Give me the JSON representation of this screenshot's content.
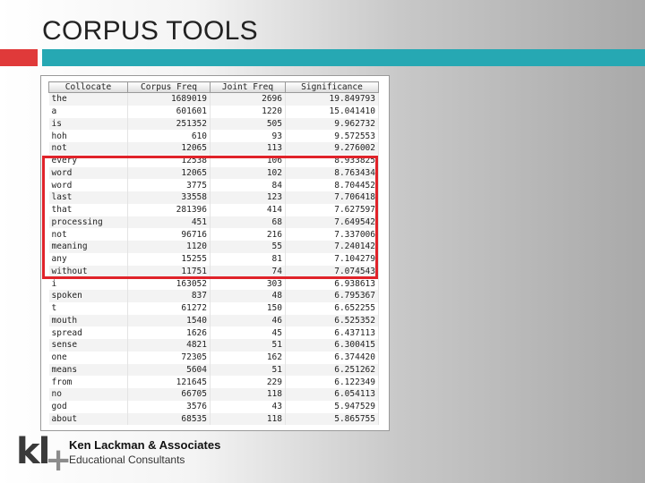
{
  "slide": {
    "title": "CORPUS TOOLS"
  },
  "table": {
    "headers": [
      "Collocate",
      "Corpus Freq",
      "Joint Freq",
      "Significance"
    ],
    "rows": [
      [
        "the",
        "1689019",
        "2696",
        "19.849793"
      ],
      [
        "a",
        "601601",
        "1220",
        "15.041410"
      ],
      [
        "is",
        "251352",
        "505",
        "9.962732"
      ],
      [
        "hoh",
        "610",
        "93",
        "9.572553"
      ],
      [
        "not",
        "12065",
        "113",
        "9.276002"
      ],
      [
        "every",
        "12538",
        "106",
        "8.933825"
      ],
      [
        "word",
        "12065",
        "102",
        "8.763434"
      ],
      [
        "word",
        "3775",
        "84",
        "8.704452"
      ],
      [
        "last",
        "33558",
        "123",
        "7.706418"
      ],
      [
        "that",
        "281396",
        "414",
        "7.627597"
      ],
      [
        "processing",
        "451",
        "68",
        "7.649542"
      ],
      [
        "not",
        "96716",
        "216",
        "7.337006"
      ],
      [
        "meaning",
        "1120",
        "55",
        "7.240142"
      ],
      [
        "any",
        "15255",
        "81",
        "7.104279"
      ],
      [
        "without",
        "11751",
        "74",
        "7.074543"
      ],
      [
        "i",
        "163052",
        "303",
        "6.938613"
      ],
      [
        "spoken",
        "837",
        "48",
        "6.795367"
      ],
      [
        "t",
        "61272",
        "150",
        "6.652255"
      ],
      [
        "mouth",
        "1540",
        "46",
        "6.525352"
      ],
      [
        "spread",
        "1626",
        "45",
        "6.437113"
      ],
      [
        "sense",
        "4821",
        "51",
        "6.300415"
      ],
      [
        "one",
        "72305",
        "162",
        "6.374420"
      ],
      [
        "means",
        "5604",
        "51",
        "6.251262"
      ],
      [
        "from",
        "121645",
        "229",
        "6.122349"
      ],
      [
        "no",
        "66705",
        "118",
        "6.054113"
      ],
      [
        "god",
        "3576",
        "43",
        "5.947529"
      ],
      [
        "about",
        "68535",
        "118",
        "5.865755"
      ]
    ]
  },
  "footer": {
    "logo_letters": "kl",
    "logo_plus": "+",
    "company": "Ken Lackman & Associates",
    "tagline": "Educational Consultants"
  },
  "colors": {
    "accent_red": "#e03a3a",
    "accent_teal": "#26a8b3",
    "highlight_border": "#e0232a"
  }
}
